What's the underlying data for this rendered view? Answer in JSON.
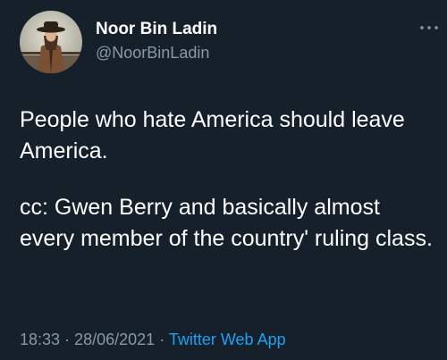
{
  "user": {
    "display_name": "Noor Bin Ladin",
    "handle": "@NoorBinLadin"
  },
  "tweet": {
    "paragraphs": [
      "People who hate America should leave America.",
      "cc: Gwen Berry and basically almost every member of the country' ruling class."
    ],
    "time": "18:33",
    "separator": "·",
    "date": "28/06/2021",
    "source": "Twitter Web App"
  },
  "icons": {
    "more": "more-horizontal-icon",
    "avatar": "profile-photo"
  },
  "colors": {
    "background": "#15202b",
    "text": "#ffffff",
    "secondary": "#8899a6",
    "link": "#1da1f2"
  }
}
